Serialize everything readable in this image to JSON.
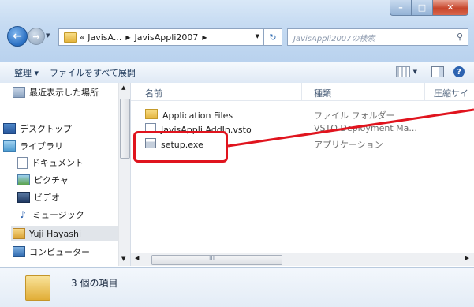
{
  "address": {
    "crumbs": [
      "« JavisA...",
      "JavisAppli2007"
    ]
  },
  "search": {
    "placeholder": "JavisAppli2007の検索"
  },
  "toolbar": {
    "organize": "整理 ▾",
    "expand_all": "ファイルをすべて展開"
  },
  "navpane": {
    "items": [
      {
        "label": "最近表示した場所",
        "icon": "recent-places-icon"
      },
      {
        "label": "デスクトップ",
        "icon": "desktop-icon"
      },
      {
        "label": "ライブラリ",
        "icon": "library-icon"
      },
      {
        "label": "ドキュメント",
        "icon": "documents-icon"
      },
      {
        "label": "ピクチャ",
        "icon": "pictures-icon"
      },
      {
        "label": "ビデオ",
        "icon": "videos-icon"
      },
      {
        "label": "ミュージック",
        "icon": "music-icon"
      },
      {
        "label": "Yuji Hayashi",
        "icon": "user-folder-icon"
      },
      {
        "label": "コンピューター",
        "icon": "computer-icon"
      }
    ]
  },
  "columns": {
    "name": "名前",
    "type": "種類",
    "compressed": "圧縮サイ"
  },
  "files": [
    {
      "name": "Application Files",
      "type": "ファイル フォルダー"
    },
    {
      "name": "JavisAppli.AddIn.vsto",
      "type": "VSTO Deployment Ma..."
    },
    {
      "name": "setup.exe",
      "type": "アプリケーション"
    }
  ],
  "hscroll": {
    "grip": "III"
  },
  "details": {
    "count": "3 個の項目"
  },
  "colors": {
    "highlight": "#e0141e",
    "accent": "#2d63b0"
  }
}
